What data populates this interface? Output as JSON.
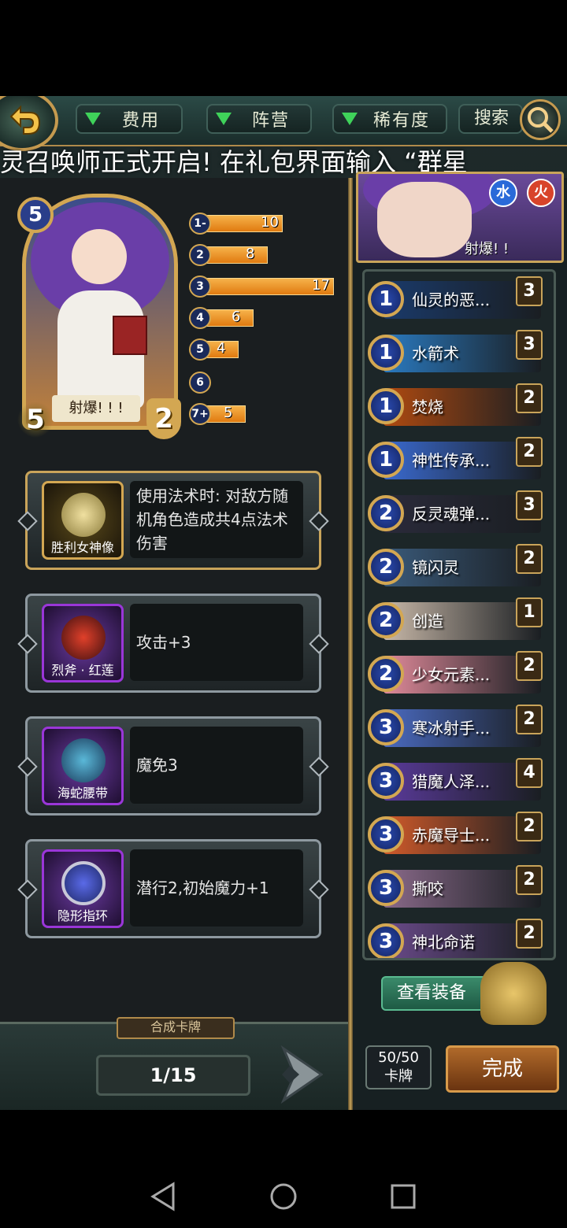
{
  "filters": {
    "cost": "费用",
    "faction": "阵营",
    "rarity": "稀有度",
    "search": "搜索"
  },
  "marquee": "灵召唤师正式开启!    在礼包界面输入 “群星",
  "selected_card": {
    "cost": "5",
    "name": "射爆! ! !",
    "attack": "5",
    "health": "2"
  },
  "mana_curve": [
    {
      "label": "1-",
      "count": "10",
      "value": 10
    },
    {
      "label": "2",
      "count": "8",
      "value": 8
    },
    {
      "label": "3",
      "count": "17",
      "value": 17
    },
    {
      "label": "4",
      "count": "6",
      "value": 6
    },
    {
      "label": "5",
      "count": "4",
      "value": 4
    },
    {
      "label": "6",
      "count": "",
      "value": 0
    },
    {
      "label": "7+",
      "count": "5",
      "value": 5
    }
  ],
  "equipment": [
    {
      "name": "胜利女神像",
      "desc": "使用法术时: 对敌方随机角色造成共4点法术伤害"
    },
    {
      "name": "烈斧 · 红莲",
      "desc": "攻击+3"
    },
    {
      "name": "海蛇腰带",
      "desc": "魔免3"
    },
    {
      "name": "隐形指环",
      "desc": "潜行2,初始魔力+1"
    }
  ],
  "bottom": {
    "synth_label": "合成卡牌",
    "page": "1/15"
  },
  "hero": {
    "element1": "水",
    "element2": "火",
    "label": "射爆! !"
  },
  "deck": [
    {
      "cost": "1",
      "name": "仙灵的恶...",
      "qty": "3",
      "color": "#1a3a6a"
    },
    {
      "cost": "1",
      "name": "水箭术",
      "qty": "3",
      "color": "#2a7ac0"
    },
    {
      "cost": "1",
      "name": "焚烧",
      "qty": "2",
      "color": "#b04a10"
    },
    {
      "cost": "1",
      "name": "神性传承...",
      "qty": "2",
      "color": "#3a6ad0"
    },
    {
      "cost": "2",
      "name": "反灵魂弹...",
      "qty": "3",
      "color": "#2a2a3a"
    },
    {
      "cost": "2",
      "name": "镜闪灵",
      "qty": "2",
      "color": "#3a5a7a"
    },
    {
      "cost": "2",
      "name": "创造",
      "qty": "1",
      "color": "#c8b8a8"
    },
    {
      "cost": "2",
      "name": "少女元素...",
      "qty": "2",
      "color": "#e08a9a"
    },
    {
      "cost": "3",
      "name": "寒冰射手...",
      "qty": "2",
      "color": "#4a6ac0"
    },
    {
      "cost": "3",
      "name": "猎魔人泽...",
      "qty": "4",
      "color": "#5a3a9a"
    },
    {
      "cost": "3",
      "name": "赤魔导士...",
      "qty": "2",
      "color": "#d05a2a"
    },
    {
      "cost": "3",
      "name": "撕咬",
      "qty": "2",
      "color": "#8a6a8a"
    },
    {
      "cost": "3",
      "name": "神北命诺",
      "qty": "2",
      "color": "#6a4a8a"
    }
  ],
  "view_equipment": "查看装备",
  "card_count": {
    "value": "50/50",
    "label": "卡牌"
  },
  "done": "完成",
  "colors": {
    "accent_gold": "#c9a45a",
    "bar_orange": "#f0962a",
    "cost_blue": "#2a4ab0"
  }
}
